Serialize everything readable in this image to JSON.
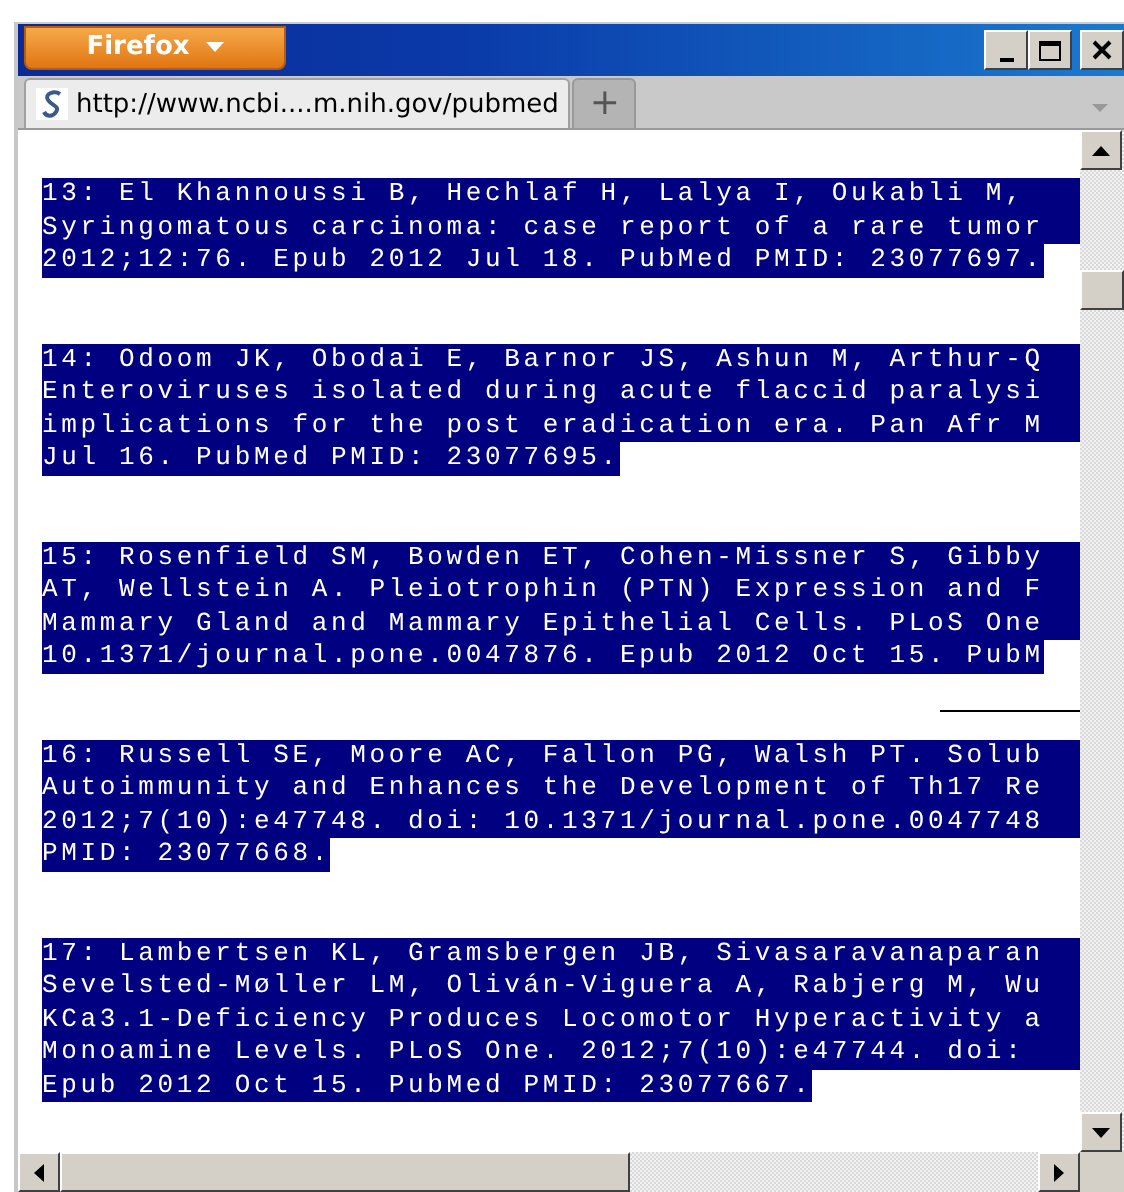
{
  "window": {
    "menu_button": "Firefox"
  },
  "tabs": [
    {
      "label": "http://www.ncbi....m.nih.gov/pubmed",
      "selected": true
    }
  ],
  "new_tab_button": "+",
  "citations": [
    {
      "lines": [
        "13: El Khannoussi B, Hechlaf H, Lalya I, Oukabli M,",
        "Syringomatous carcinoma: case report of a rare tumor",
        "2012;12:76. Epub 2012 Jul 18. PubMed PMID: 23077697."
      ]
    },
    {
      "lines": [
        "14: Odoom JK, Obodai E, Barnor JS, Ashun M, Arthur-Q",
        "Enteroviruses isolated during acute flaccid paralysi",
        "implications for the post eradication era. Pan Afr M",
        "Jul 16. PubMed PMID: 23077695."
      ]
    },
    {
      "lines": [
        "15: Rosenfield SM, Bowden ET, Cohen-Missner S, Gibby",
        "AT, Wellstein A. Pleiotrophin (PTN) Expression and F",
        "Mammary Gland and Mammary Epithelial Cells. PLoS One",
        "10.1371/journal.pone.0047876. Epub 2012 Oct 15. PubM"
      ]
    },
    {
      "lines": [
        "16: Russell SE, Moore AC, Fallon PG, Walsh PT. Solub",
        "Autoimmunity and Enhances the Development of Th17 Re",
        "2012;7(10):e47748. doi: 10.1371/journal.pone.0047748",
        "PMID: 23077668."
      ]
    },
    {
      "lines": [
        "17: Lambertsen KL, Gramsbergen JB, Sivasaravanaparan",
        "Sevelsted-Møller LM, Oliván-Viguera A, Rabjerg M, Wu",
        "KCa3.1-Deficiency Produces Locomotor Hyperactivity a",
        "Monoamine Levels. PLoS One. 2012;7(10):e47744. doi:",
        "Epub 2012 Oct 15. PubMed PMID: 23077667."
      ]
    }
  ]
}
